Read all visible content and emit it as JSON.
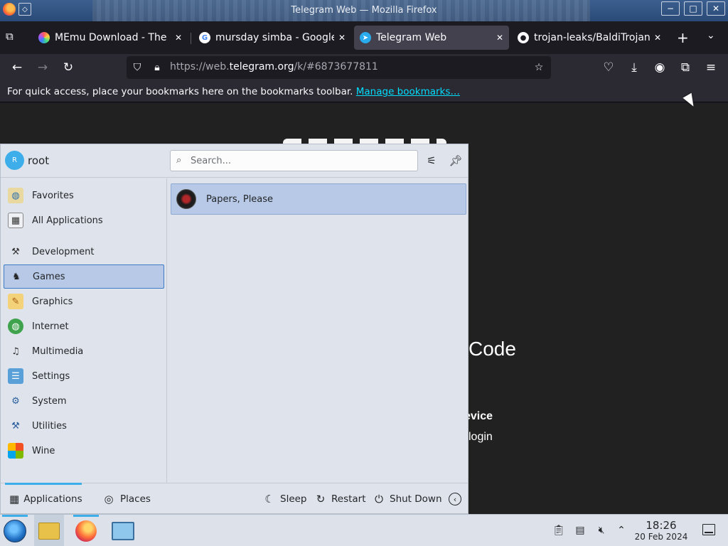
{
  "window": {
    "title": "Telegram Web — Mozilla Firefox",
    "controls": {
      "minimize": "−",
      "maximize": "□",
      "close": "✕"
    }
  },
  "tabs": [
    {
      "label": "MEmu Download - The Be",
      "icon": "memu-icon",
      "active": false
    },
    {
      "label": "mursday simba - Google",
      "icon": "google-icon",
      "active": false
    },
    {
      "label": "Telegram Web",
      "icon": "telegram-icon",
      "active": true
    },
    {
      "label": "trojan-leaks/BaldiTrojan-",
      "icon": "github-icon",
      "active": false
    }
  ],
  "tab_close_glyph": "✕",
  "new_tab_glyph": "+",
  "tab_list_glyph": "⌄",
  "navbar": {
    "url_prefix": "https://web.",
    "url_domain": "telegram.org",
    "url_path": "/k/#6873677811"
  },
  "bookmarks_toolbar": {
    "text": "For quick access, place your bookmarks here on the bookmarks toolbar.",
    "link": "Manage bookmarks…"
  },
  "telegram_page": {
    "heading_fragment": "Code",
    "device_fragment": "evice",
    "login_fragment": "login"
  },
  "launcher": {
    "user": {
      "initial": "R",
      "name": "root"
    },
    "search": {
      "placeholder": "Search..."
    },
    "categories": [
      {
        "label": "Favorites",
        "icon": "favorites-icon",
        "selected": false
      },
      {
        "label": "All Applications",
        "icon": "all-applications-icon",
        "selected": false
      },
      {
        "label": "Development",
        "icon": "development-icon",
        "selected": false
      },
      {
        "label": "Games",
        "icon": "games-icon",
        "selected": true
      },
      {
        "label": "Graphics",
        "icon": "graphics-icon",
        "selected": false
      },
      {
        "label": "Internet",
        "icon": "internet-icon",
        "selected": false
      },
      {
        "label": "Multimedia",
        "icon": "multimedia-icon",
        "selected": false
      },
      {
        "label": "Settings",
        "icon": "settings-icon",
        "selected": false
      },
      {
        "label": "System",
        "icon": "system-icon",
        "selected": false
      },
      {
        "label": "Utilities",
        "icon": "utilities-icon",
        "selected": false
      },
      {
        "label": "Wine",
        "icon": "wine-icon",
        "selected": false
      }
    ],
    "apps": [
      {
        "label": "Papers, Please",
        "icon": "papers-please-icon"
      }
    ],
    "bottom_tabs": {
      "applications": "Applications",
      "places": "Places"
    },
    "power": {
      "sleep": "Sleep",
      "restart": "Restart",
      "shutdown": "Shut Down"
    }
  },
  "taskbar": {
    "clock": {
      "time": "18:26",
      "date": "20 Feb 2024"
    }
  },
  "colors": {
    "accent": "#3daee9",
    "selection_bg": "#b7c9e6",
    "selection_border": "#3d7bc4",
    "firefox_dark": "#1c1b22",
    "firefox_toolbar": "#2b2a33",
    "active_tab": "#42414d",
    "link": "#00ddff",
    "launcher_bg": "#dfe4ec"
  }
}
